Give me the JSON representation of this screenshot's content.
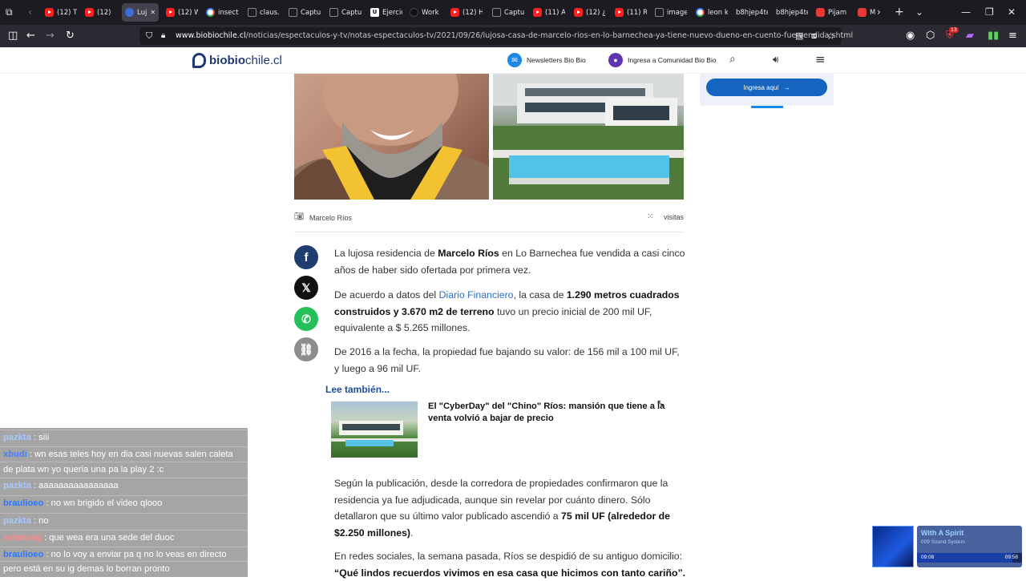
{
  "tabs": [
    {
      "label": "(12) Tl",
      "favicon": "youtube-icon"
    },
    {
      "label": "(12) ",
      "favicon": "youtube-icon"
    },
    {
      "label": "Luj",
      "favicon": "biobio-icon",
      "active": true
    },
    {
      "label": "(12) W",
      "favicon": "youtube-icon"
    },
    {
      "label": "insect",
      "favicon": "google-icon"
    },
    {
      "label": "claus.",
      "favicon": "cloud-icon"
    },
    {
      "label": "Captu",
      "favicon": "globe-icon"
    },
    {
      "label": "Captu",
      "favicon": "globe-icon"
    },
    {
      "label": "Ejercic",
      "favicon": "ucampus-icon"
    },
    {
      "label": "Work",
      "favicon": "github-icon"
    },
    {
      "label": "(12) H",
      "favicon": "youtube-icon"
    },
    {
      "label": "Captu",
      "favicon": "cloud-icon"
    },
    {
      "label": "(11) A",
      "favicon": "youtube-icon"
    },
    {
      "label": "(12) ¿",
      "favicon": "youtube-icon"
    },
    {
      "label": "(11) R",
      "favicon": "youtube-icon"
    },
    {
      "label": "image",
      "favicon": "cloud-icon"
    },
    {
      "label": "leon k",
      "favicon": "google-icon"
    },
    {
      "label": "b8hjep4te",
      "favicon": ""
    },
    {
      "label": "b8hjep4te",
      "favicon": ""
    },
    {
      "label": "Pijam",
      "favicon": "red-icon"
    },
    {
      "label": "M",
      "favicon": "red-icon"
    }
  ],
  "address": {
    "url_domain": "www.biobiochile.cl",
    "url_path": "/noticias/espectaculos-y-tv/notas-espectaculos-tv/2021/09/26/lujosa-casa-de-marcelo-rios-en-lo-barnechea-ya-tiene-nuevo-dueno-en-cuento-fue-vendida.shtml",
    "badge_count": "13"
  },
  "site": {
    "logo_bold": "biobio",
    "logo_light": "chile.cl",
    "newsletters_label": "Newsletters Bio Bio",
    "community_label": "Ingresa a Comunidad Bio Bio",
    "sidebar_button": "Ingresa aquí"
  },
  "article": {
    "photo_caption": "Marcelo Ríos",
    "visits_label": "visitas",
    "p1_a": "La lujosa residencia de ",
    "p1_b": "Marcelo Ríos",
    "p1_c": " en Lo Barnechea fue vendida a casi cinco años de haber sido ofertada por primera vez.",
    "p2_a": "De acuerdo a datos del ",
    "p2_link": "Diario Financiero",
    "p2_b": ", la casa de ",
    "p2_bold": "1.290 metros cuadrados construidos y 3.670 m2 de terreno",
    "p2_c": " tuvo un precio inicial de 200 mil UF, equivalente a $ 5.265 millones.",
    "p3": "De 2016 a la fecha, la propiedad fue bajando su valor: de 156 mil a 100 mil UF, y luego a 96 mil UF.",
    "lee_tambien": "Lee también...",
    "related_title": "El \"CyberDay\" del \"Chino\" Ríos: mansión que tiene a la venta volvió a bajar de precio",
    "p4_a": "Según la publicación, desde la corredora de propiedades confirmaron que la residencia ya fue adjudicada, aunque sin revelar por cuánto dinero. Sólo detallaron que su último valor publicado ascendió a ",
    "p4_bold": "75 mil UF (alrededor de $2.250 millones)",
    "p4_c": ".",
    "p5_a": "En redes sociales, la semana pasada, Ríos se despidió de su antiguo domicilio: ",
    "p5_bold": "“Qué lindos recuerdos vivimos en esa casa que hicimos con tanto cariño”."
  },
  "chat": [
    {
      "user": "pazkta",
      "text": " : siii",
      "color": "#a8c8ff"
    },
    {
      "user": "xbudi",
      "text": " : wn esas teles hoy en dia casi nuevas salen caleta",
      "color": "#4a7cff"
    },
    {
      "user": "",
      "text": "de plata wn yo queria una pa la play 2 :c",
      "color": "#ffffff"
    },
    {
      "user": "pazkta",
      "text": " : aaaaaaaaaaaaaaaa",
      "color": "#a8c8ff"
    },
    {
      "user": "braulioeo",
      "text": " : no wn brigido el video qlooo",
      "color": "#2979ff"
    },
    {
      "user": "pazkta",
      "text": " : no",
      "color": "#a8c8ff"
    },
    {
      "user": "sebavalg",
      "text": " : que wea era una sede del duoc",
      "color": "#ff8a8a"
    },
    {
      "user": "braulioeo",
      "text": " : no lo voy a enviar pa q no lo veas en directo",
      "color": "#2979ff"
    },
    {
      "user": "",
      "text": "pero está en su ig demas lo borran pronto",
      "color": "#ffffff"
    }
  ],
  "music": {
    "title": "With A Spirit",
    "artist": "009 Sound System",
    "elapsed": "09:08",
    "total": "09:58",
    "progress": 0.91
  }
}
